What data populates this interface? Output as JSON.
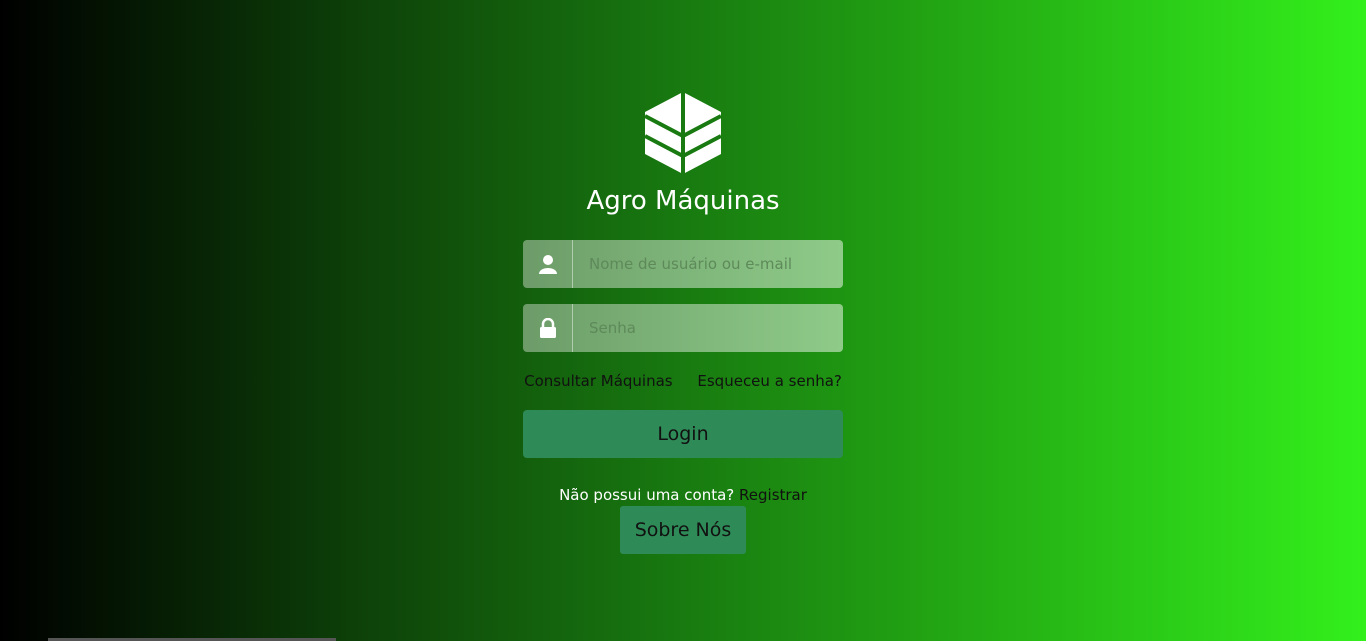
{
  "brand": {
    "name": "Agro Máquinas",
    "logo_icon": "leaf-hexagon-icon"
  },
  "form": {
    "username": {
      "placeholder": "Nome de usuário ou e-mail",
      "value": "",
      "icon": "user-icon"
    },
    "password": {
      "placeholder": "Senha",
      "value": "",
      "icon": "lock-icon"
    },
    "links": {
      "consult": "Consultar Máquinas",
      "forgot": "Esqueceu a senha?"
    },
    "login_label": "Login"
  },
  "register": {
    "prompt": "Não possui uma conta?",
    "link": "Registrar"
  },
  "about_label": "Sobre Nós",
  "colors": {
    "gradient_start": "#000000",
    "gradient_end": "#33f01c",
    "button": "#2e8b57"
  }
}
